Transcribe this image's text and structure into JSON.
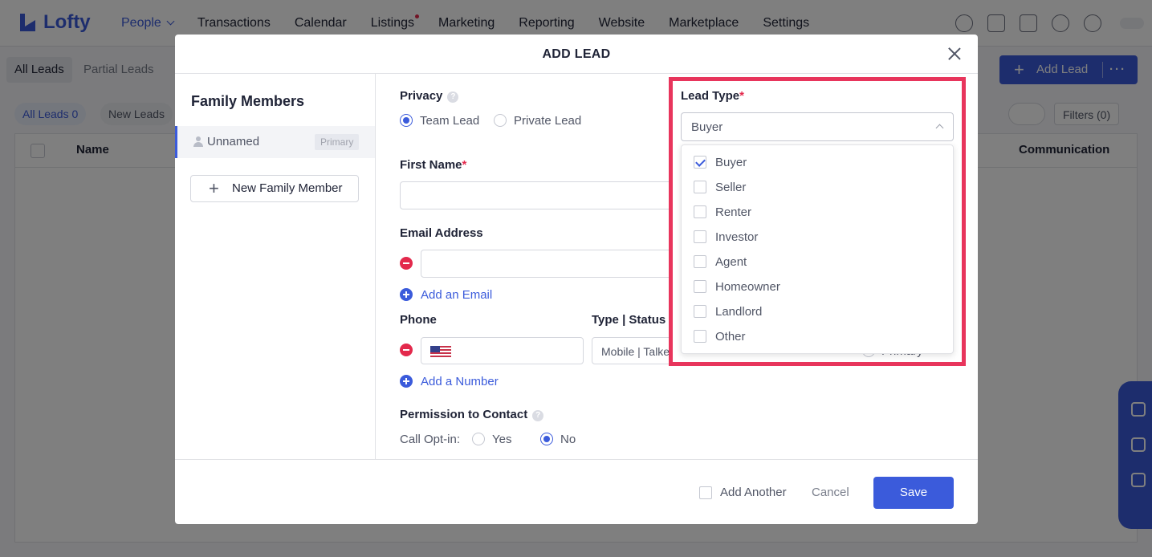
{
  "app": {
    "brand": "Lofty",
    "brand_color": "#3b5bdb"
  },
  "nav": {
    "items": [
      "People",
      "Transactions",
      "Calendar",
      "Listings",
      "Marketing",
      "Reporting",
      "Website",
      "Marketplace",
      "Settings"
    ],
    "active": "People",
    "icons": [
      "search-icon",
      "inbox-icon",
      "dollar-icon",
      "bell-icon",
      "help-icon"
    ]
  },
  "subtabs": [
    "All Leads",
    "Partial Leads"
  ],
  "add_lead_label": "Add Lead",
  "chips": {
    "all_leads": "All Leads",
    "all_leads_count": "0",
    "new_leads": "New Leads"
  },
  "filters_label": "Filters (0)",
  "table": {
    "headers": [
      "Name",
      "Communication"
    ]
  },
  "modal": {
    "title": "ADD LEAD",
    "family_title": "Family Members",
    "member_name": "Unnamed",
    "member_badge": "Primary",
    "new_member_label": "New Family Member",
    "privacy_label": "Privacy",
    "privacy_options": [
      "Team Lead",
      "Private Lead"
    ],
    "privacy_selected": "Team Lead",
    "first_name_label": "First Name",
    "email_label": "Email Address",
    "add_email_label": "Add an Email",
    "phone_label": "Phone",
    "type_status_label": "Type | Status",
    "phone_type_value": "Mobile | Talked",
    "phone_primary_label": "Primary",
    "add_number_label": "Add a Number",
    "permission_label": "Permission to Contact",
    "call_optin_label": "Call Opt-in:",
    "call_optin_options": [
      "Yes",
      "No"
    ],
    "call_optin_selected": "No",
    "lead_type_label": "Lead Type",
    "lead_type_value": "Buyer",
    "lead_type_options": [
      {
        "label": "Buyer",
        "checked": true
      },
      {
        "label": "Seller",
        "checked": false
      },
      {
        "label": "Renter",
        "checked": false
      },
      {
        "label": "Investor",
        "checked": false
      },
      {
        "label": "Agent",
        "checked": false
      },
      {
        "label": "Homeowner",
        "checked": false
      },
      {
        "label": "Landlord",
        "checked": false
      },
      {
        "label": "Other",
        "checked": false
      }
    ],
    "add_another_label": "Add Another",
    "cancel_label": "Cancel",
    "save_label": "Save"
  }
}
